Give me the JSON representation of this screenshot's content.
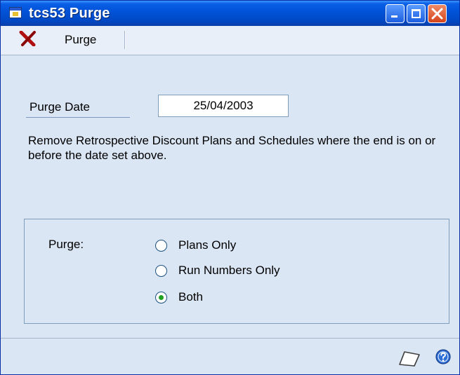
{
  "window": {
    "title": "tcs53 Purge",
    "buttons": [
      "minimize-icon",
      "maximize-icon",
      "close-icon"
    ]
  },
  "toolbar": {
    "purge_label": "Purge",
    "icon": "red-x-icon"
  },
  "form": {
    "purge_date_label": "Purge Date",
    "purge_date_value": "25/04/2003",
    "description": "Remove Retrospective Discount Plans and Schedules where the end is on or before the date set above.",
    "purge_label": "Purge:",
    "options": [
      {
        "label": "Plans Only",
        "selected": false
      },
      {
        "label": "Run Numbers Only",
        "selected": false
      },
      {
        "label": "Both",
        "selected": true
      }
    ]
  },
  "statusbar": {
    "icons": [
      "note-icon",
      "help-icon"
    ]
  },
  "colors": {
    "titlebar": "#0052d6",
    "background": "#dbe6f5",
    "radio_dot": "#21a121",
    "close_button": "#d4441c"
  }
}
